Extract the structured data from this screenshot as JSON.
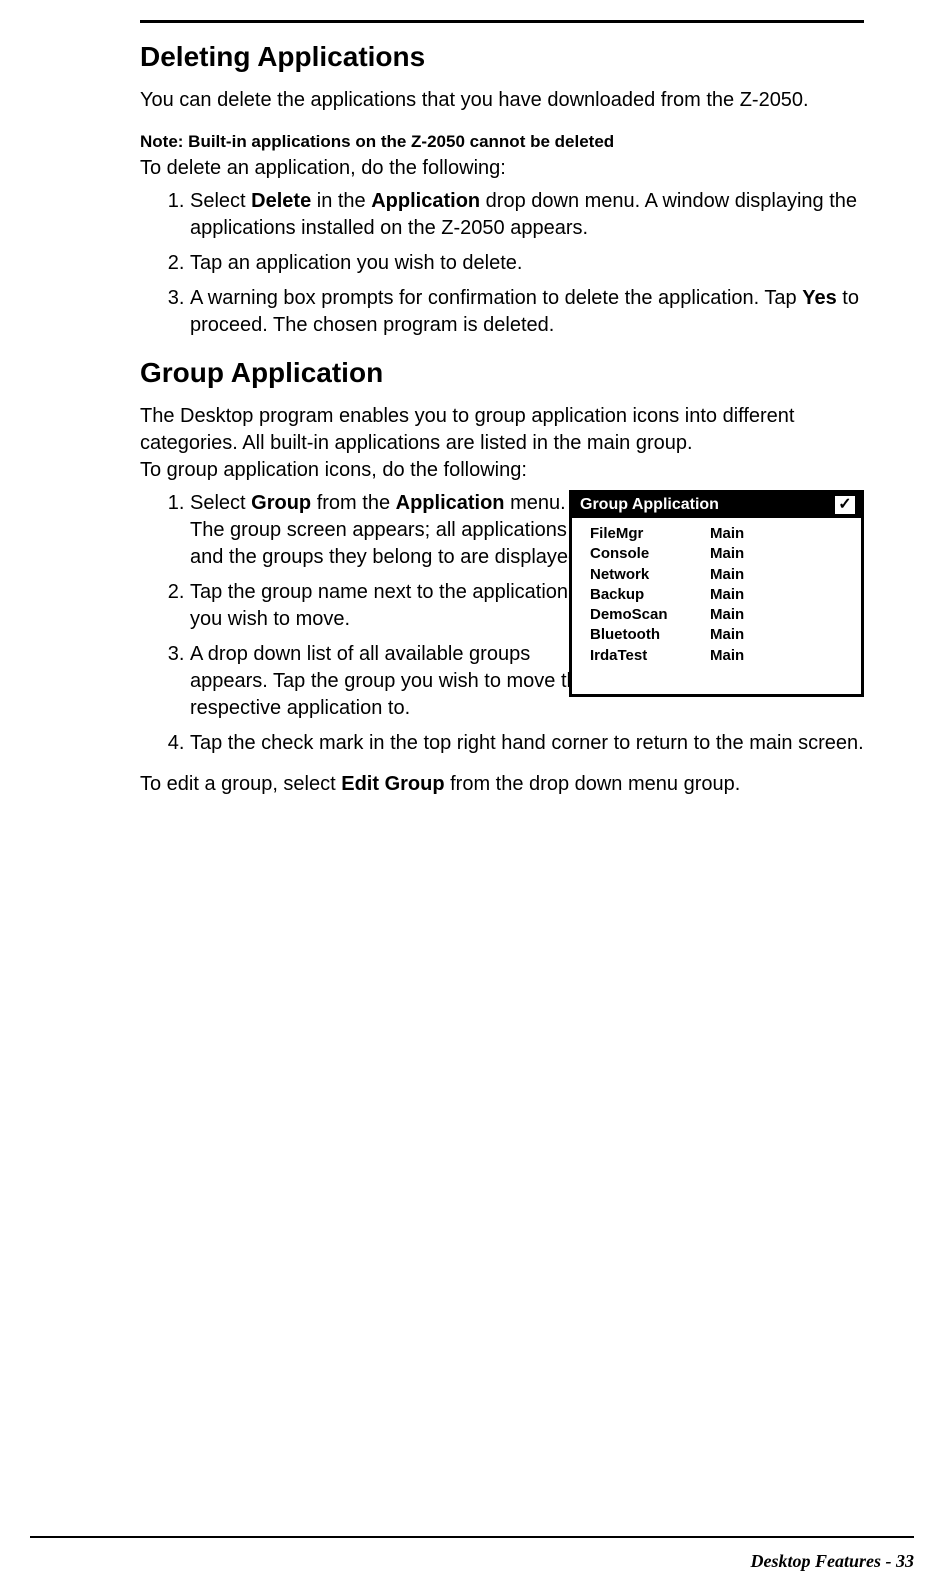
{
  "section1": {
    "heading": "Deleting Applications",
    "intro": "You can delete the applications that you have downloaded from the Z-2050.",
    "note": "Note: Built-in applications on the Z-2050 cannot be deleted",
    "lead": "To delete an application, do the following:",
    "steps": {
      "s1a": "Select ",
      "s1b": "Delete",
      "s1c": " in the ",
      "s1d": "Application",
      "s1e": " drop down menu. A window displaying the applications installed on the Z-2050 appears.",
      "s2": "Tap an application you wish to delete.",
      "s3a": "A warning box prompts for confirmation to delete the application. Tap ",
      "s3b": "Yes",
      "s3c": " to proceed. The chosen program is deleted."
    }
  },
  "section2": {
    "heading": "Group Application",
    "intro": "The Desktop program enables you to group application icons into different categories. All built-in applications are listed in the main group.",
    "lead": "To group application icons, do the following:",
    "steps": {
      "s1a": "Select ",
      "s1b": "Group",
      "s1c": " from the ",
      "s1d": "Application",
      "s1e": " menu. The group screen appears; all applications and the groups they belong to are displayed.",
      "s2": "Tap the group name next to the application you wish to move.",
      "s3": "A drop down list of all available groups appears. Tap the group you wish to move the respective application to.",
      "s4": "Tap the check mark in the top right hand corner to return to the main screen."
    },
    "outro_a": "To edit a group, select ",
    "outro_b": "Edit Group",
    "outro_c": " from the drop down menu group."
  },
  "figure": {
    "title": "Group Application",
    "check": "✓",
    "rows": [
      {
        "app": "FileMgr",
        "grp": "Main"
      },
      {
        "app": "Console",
        "grp": "Main"
      },
      {
        "app": "Network",
        "grp": "Main"
      },
      {
        "app": "Backup",
        "grp": "Main"
      },
      {
        "app": "DemoScan",
        "grp": "Main"
      },
      {
        "app": "Bluetooth",
        "grp": "Main"
      },
      {
        "app": "IrdaTest",
        "grp": "Main"
      }
    ]
  },
  "footer": "Desktop Features - 33"
}
